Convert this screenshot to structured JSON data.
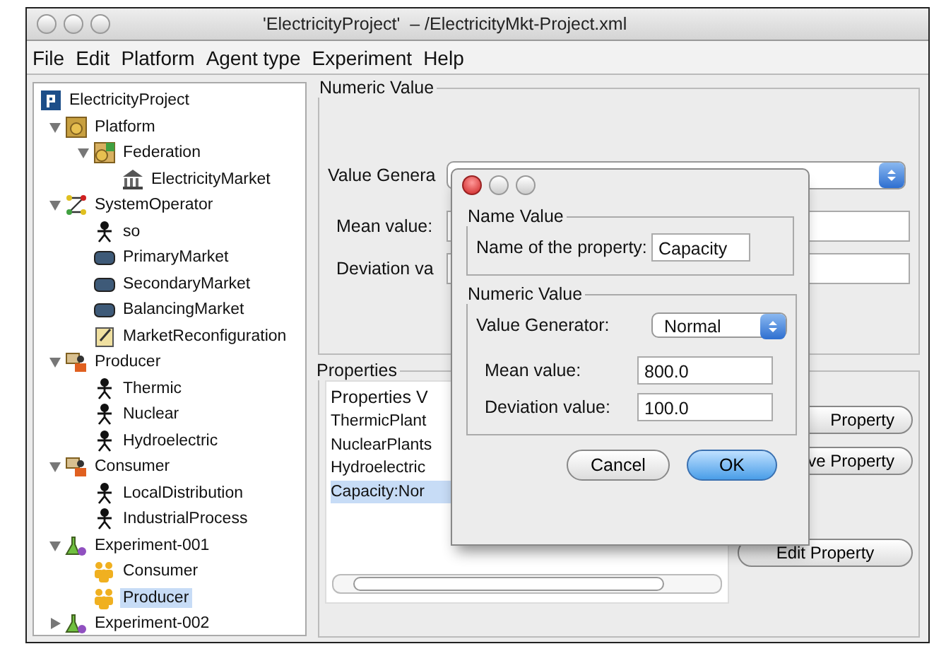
{
  "window": {
    "title": "'ElectricityProject'  – /ElectricityMkt-Project.xml"
  },
  "menu": [
    "File",
    "Edit",
    "Platform",
    "Agent type",
    "Experiment",
    "Help"
  ],
  "tree": {
    "label": "ElectricityProject",
    "kind": "project",
    "selected": false,
    "children": [
      {
        "label": "Platform",
        "kind": "platform",
        "selected": false,
        "expanded": true,
        "children": [
          {
            "label": "Federation",
            "kind": "federation",
            "selected": false,
            "expanded": true,
            "children": [
              {
                "label": "ElectricityMarket",
                "kind": "market-building",
                "selected": false
              }
            ]
          }
        ]
      },
      {
        "label": "SystemOperator",
        "kind": "network",
        "selected": false,
        "expanded": true,
        "children": [
          {
            "label": "so",
            "kind": "agent",
            "selected": false
          },
          {
            "label": "PrimaryMarket",
            "kind": "market",
            "selected": false
          },
          {
            "label": "SecondaryMarket",
            "kind": "market",
            "selected": false
          },
          {
            "label": "BalancingMarket",
            "kind": "market",
            "selected": false
          },
          {
            "label": "MarketReconfiguration",
            "kind": "note",
            "selected": false
          }
        ]
      },
      {
        "label": "Producer",
        "kind": "agent-type",
        "selected": false,
        "expanded": true,
        "children": [
          {
            "label": "Thermic",
            "kind": "agent",
            "selected": false
          },
          {
            "label": "Nuclear",
            "kind": "agent",
            "selected": false
          },
          {
            "label": "Hydroelectric",
            "kind": "agent",
            "selected": false
          }
        ]
      },
      {
        "label": "Consumer",
        "kind": "agent-type",
        "selected": false,
        "expanded": true,
        "children": [
          {
            "label": "LocalDistribution",
            "kind": "agent",
            "selected": false
          },
          {
            "label": "IndustrialProcess",
            "kind": "agent",
            "selected": false
          }
        ]
      },
      {
        "label": "Experiment-001",
        "kind": "experiment",
        "selected": false,
        "expanded": true,
        "children": [
          {
            "label": "Consumer",
            "kind": "population",
            "selected": false
          },
          {
            "label": "Producer",
            "kind": "population",
            "selected": true
          }
        ]
      },
      {
        "label": "Experiment-002",
        "kind": "experiment",
        "selected": false,
        "expanded": false
      }
    ]
  },
  "numeric_panel": {
    "title": "Numeric Value",
    "generator_label": "Value Genera",
    "mean_label": "Mean value:",
    "deviation_label": "Deviation va"
  },
  "properties_panel": {
    "title": "Properties",
    "list_title": "Properties V",
    "items": [
      {
        "text": "ThermicPlant",
        "selected": false
      },
      {
        "text": "NuclearPlants",
        "selected": false
      },
      {
        "text": "Hydroelectric",
        "selected": false
      },
      {
        "text": "Capacity:Nor",
        "selected": true
      }
    ],
    "buttons": [
      "Property",
      "ve Property",
      "Edit Property"
    ]
  },
  "dialog": {
    "name_group": "Name Value",
    "name_label": "Name of the property:",
    "name_value": "Capacity",
    "numeric_group": "Numeric Value",
    "generator_label": "Value Generator:",
    "generator_value": "Normal",
    "mean_label": "Mean value:",
    "mean_value": "800.0",
    "deviation_label": "Deviation value:",
    "deviation_value": "100.0",
    "buttons": [
      {
        "label": "Cancel",
        "default": false
      },
      {
        "label": "OK",
        "default": true
      }
    ]
  }
}
